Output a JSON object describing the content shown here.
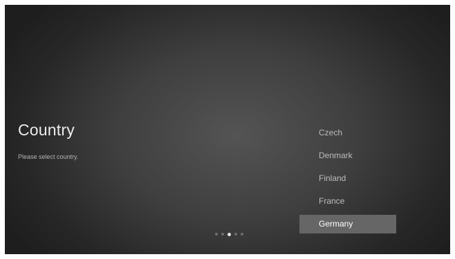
{
  "page": {
    "title": "Country",
    "subtitle": "Please select country."
  },
  "countries": {
    "items": [
      {
        "label": "Czech",
        "selected": false
      },
      {
        "label": "Denmark",
        "selected": false
      },
      {
        "label": "Finland",
        "selected": false
      },
      {
        "label": "France",
        "selected": false
      },
      {
        "label": "Germany",
        "selected": true
      }
    ],
    "selected_label": "Germany"
  },
  "pager": {
    "total_steps": 5,
    "current_step": 3
  },
  "colors": {
    "background_center": "#545454",
    "background_edge": "#1e1e1e",
    "selected_highlight": "#666666",
    "active_dot": "#e6e6e6",
    "inactive_dot": "#6e6e6e"
  }
}
